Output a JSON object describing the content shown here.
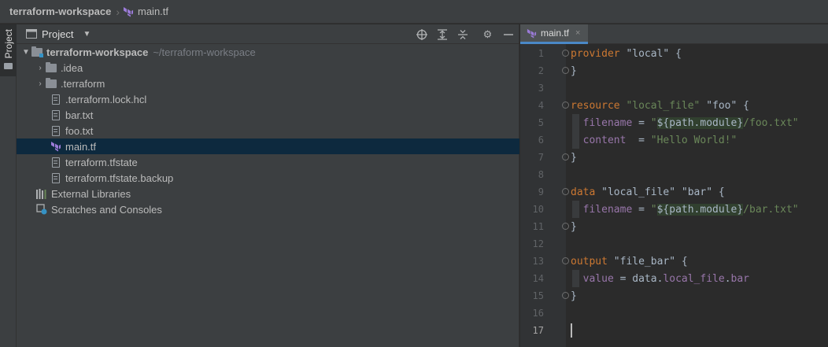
{
  "breadcrumb": {
    "root": "terraform-workspace",
    "file": "main.tf"
  },
  "stripe": {
    "label": "Project"
  },
  "project_panel": {
    "title": "Project",
    "tree": [
      {
        "label": "terraform-workspace",
        "hint": "~/terraform-workspace",
        "kind": "root",
        "expanded": true
      },
      {
        "label": ".idea",
        "kind": "folder"
      },
      {
        "label": ".terraform",
        "kind": "folder"
      },
      {
        "label": ".terraform.lock.hcl",
        "kind": "file"
      },
      {
        "label": "bar.txt",
        "kind": "file"
      },
      {
        "label": "foo.txt",
        "kind": "file"
      },
      {
        "label": "main.tf",
        "kind": "terraform",
        "selected": true
      },
      {
        "label": "terraform.tfstate",
        "kind": "file"
      },
      {
        "label": "terraform.tfstate.backup",
        "kind": "file"
      },
      {
        "label": "External Libraries",
        "kind": "library"
      },
      {
        "label": "Scratches and Consoles",
        "kind": "scratch"
      }
    ]
  },
  "editor": {
    "tab": {
      "label": "main.tf",
      "close": "×"
    },
    "current_line": 17,
    "lines": [
      {
        "n": "1",
        "tokens": [
          [
            "kw",
            "provider"
          ],
          [
            "plain",
            " "
          ],
          [
            "plain",
            "\"local\""
          ],
          [
            "plain",
            " {"
          ]
        ]
      },
      {
        "n": "2",
        "tokens": [
          [
            "plain",
            "}"
          ]
        ]
      },
      {
        "n": "3",
        "tokens": []
      },
      {
        "n": "4",
        "tokens": [
          [
            "kw",
            "resource"
          ],
          [
            "plain",
            " "
          ],
          [
            "str",
            "\"local_file\""
          ],
          [
            "plain",
            " \"foo\" {"
          ]
        ]
      },
      {
        "n": "5",
        "tokens": [
          [
            "prop",
            "  filename"
          ],
          [
            "plain",
            " = "
          ],
          [
            "str",
            "\""
          ],
          [
            "interp",
            "${path.module}"
          ],
          [
            "str",
            "/foo.txt\""
          ]
        ]
      },
      {
        "n": "6",
        "tokens": [
          [
            "prop",
            "  content"
          ],
          [
            "plain",
            "  = "
          ],
          [
            "str",
            "\"Hello World!\""
          ]
        ]
      },
      {
        "n": "7",
        "tokens": [
          [
            "plain",
            "}"
          ]
        ]
      },
      {
        "n": "8",
        "tokens": []
      },
      {
        "n": "9",
        "tokens": [
          [
            "kw",
            "data"
          ],
          [
            "plain",
            " "
          ],
          [
            "plain",
            "\"local_file\""
          ],
          [
            "plain",
            " \"bar\" {"
          ]
        ]
      },
      {
        "n": "10",
        "tokens": [
          [
            "prop",
            "  filename"
          ],
          [
            "plain",
            " = "
          ],
          [
            "str",
            "\""
          ],
          [
            "interp",
            "${path.module}"
          ],
          [
            "str",
            "/bar.txt\""
          ]
        ]
      },
      {
        "n": "11",
        "tokens": [
          [
            "plain",
            "}"
          ]
        ]
      },
      {
        "n": "12",
        "tokens": []
      },
      {
        "n": "13",
        "tokens": [
          [
            "kw",
            "output"
          ],
          [
            "plain",
            " \"file_bar\" {"
          ]
        ]
      },
      {
        "n": "14",
        "tokens": [
          [
            "prop",
            "  value"
          ],
          [
            "plain",
            " = data."
          ],
          [
            "prop",
            "local_file"
          ],
          [
            "plain",
            "."
          ],
          [
            "prop",
            "bar"
          ]
        ]
      },
      {
        "n": "15",
        "tokens": [
          [
            "plain",
            "}"
          ]
        ]
      },
      {
        "n": "16",
        "tokens": []
      },
      {
        "n": "17",
        "tokens": []
      }
    ]
  },
  "colors": {
    "selection": "#0d293e",
    "keyword": "#cc7832",
    "string": "#6a8759",
    "property": "#9876aa",
    "accent": "#4a88c7"
  }
}
